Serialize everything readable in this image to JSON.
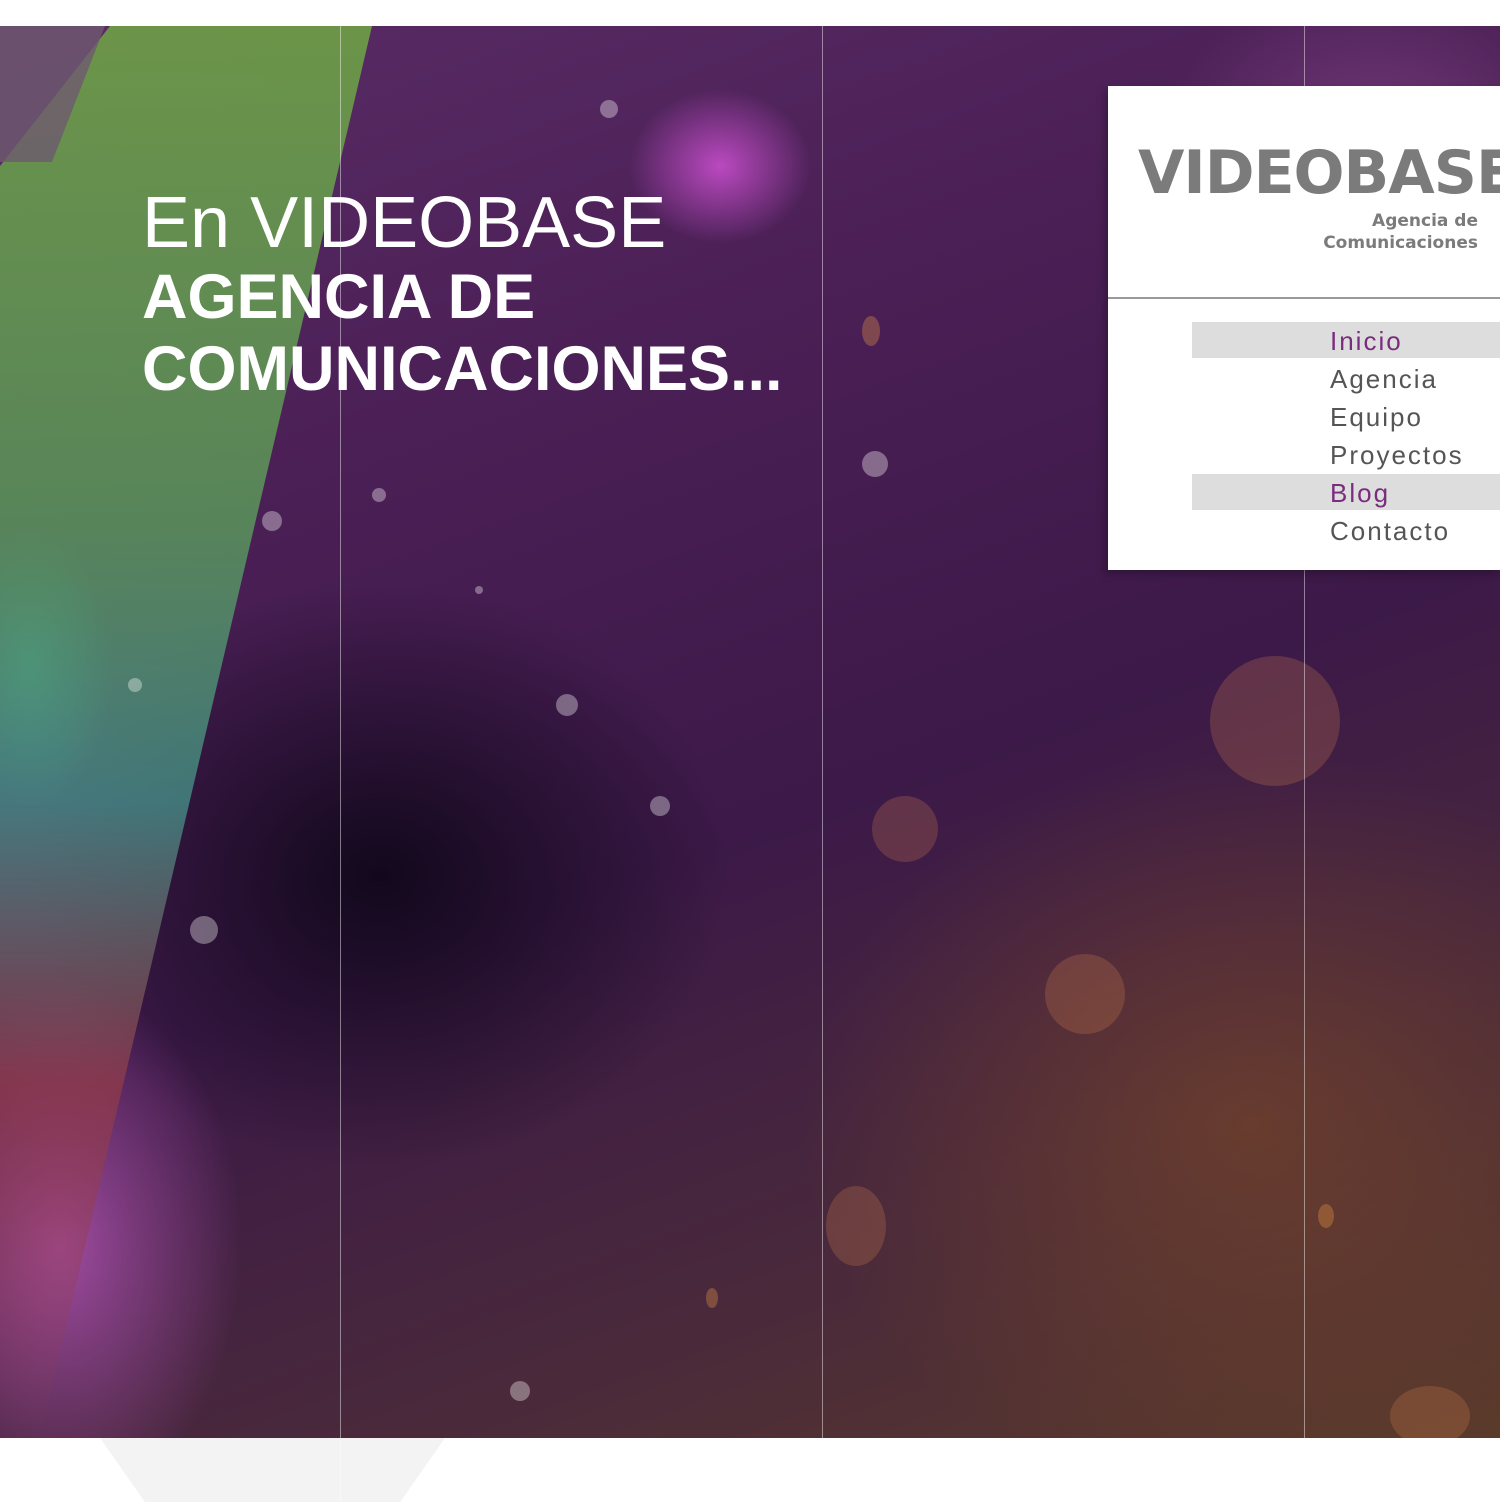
{
  "hero": {
    "headline_line1": "En VIDEOBASE",
    "headline_line2": "AGENCIA DE",
    "headline_line3": "COMUNICACIONES..."
  },
  "brand": {
    "logo_text": "VIDEOBASE",
    "tagline_line1": "Agencia de",
    "tagline_line2": "Comunicaciones"
  },
  "nav": {
    "items": [
      {
        "label": "Inicio",
        "highlighted": true
      },
      {
        "label": "Agencia",
        "highlighted": false
      },
      {
        "label": "Equipo",
        "highlighted": false
      },
      {
        "label": "Proyectos",
        "highlighted": false
      },
      {
        "label": "Blog",
        "highlighted": true
      },
      {
        "label": "Contacto",
        "highlighted": false
      }
    ]
  },
  "colors": {
    "accent": "#7a2d7e",
    "logo_gray": "#7b7b7b",
    "highlight_bg": "#dddddd"
  }
}
